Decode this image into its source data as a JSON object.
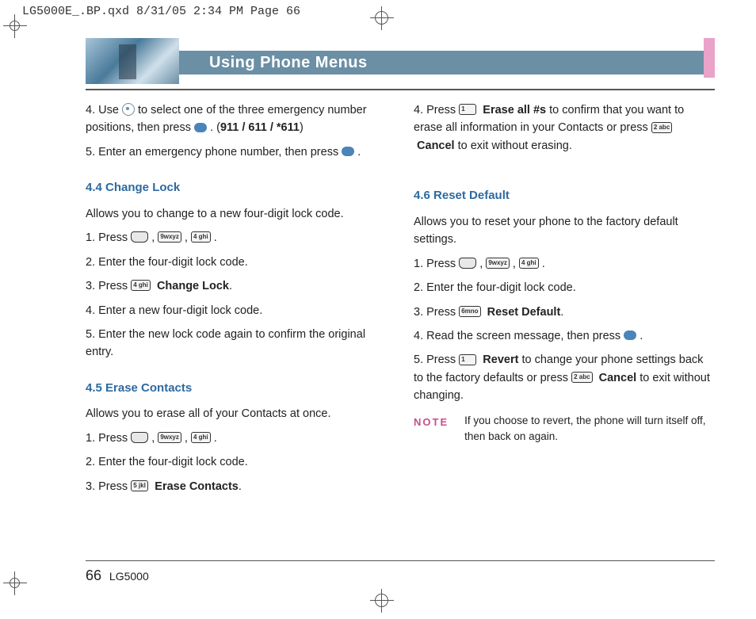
{
  "meta_header": "LG5000E_.BP.qxd  8/31/05  2:34 PM  Page 66",
  "title": "Using Phone Menus",
  "left": {
    "step4_a": "4. Use ",
    "step4_b": " to select one of the three emergency number positions, then press ",
    "step4_c": ".   (",
    "emerg": "911 / 611 / *611",
    "step4_d": ")",
    "step5": "5. Enter an emergency phone number, then press ",
    "step5_end": ".",
    "sec44": "4.4 Change Lock",
    "s44_intro": "Allows you to change to a new four-digit lock code.",
    "s44_1a": "1. Press ",
    "s44_1b": " , ",
    "s44_1c": " , ",
    "s44_1d": " .",
    "s44_2": "2. Enter the four-digit lock code.",
    "s44_3a": "3. Press ",
    "s44_3b": "Change Lock",
    "s44_3c": ".",
    "s44_4": "4. Enter a new four-digit lock code.",
    "s44_5": "5. Enter the new lock code again to confirm the original entry.",
    "sec45": "4.5 Erase Contacts",
    "s45_intro": "Allows you to erase all of your Contacts at once.",
    "s45_1a": "1. Press ",
    "s45_1b": " , ",
    "s45_1c": " , ",
    "s45_1d": " .",
    "s45_2": "2. Enter the four-digit lock code.",
    "s45_3a": "3. Press ",
    "s45_3b": "Erase Contacts",
    "s45_3c": "."
  },
  "right": {
    "step4_a": "4. Press ",
    "step4_b": "Erase all #s",
    "step4_c": " to confirm that you want to erase all information in your Contacts or press ",
    "step4_d": "Cancel",
    "step4_e": " to exit without erasing.",
    "sec46": "4.6 Reset Default",
    "s46_intro": "Allows you to reset your phone to the factory default settings.",
    "s46_1a": "1. Press ",
    "s46_1b": " , ",
    "s46_1c": " , ",
    "s46_1d": " .",
    "s46_2": "2. Enter the four-digit lock code.",
    "s46_3a": "3. Press ",
    "s46_3b": "Reset Default",
    "s46_3c": ".",
    "s46_4a": "4. Read the screen message, then press ",
    "s46_4b": ".",
    "s46_5a": "5. Press ",
    "s46_5b": "Revert",
    "s46_5c": " to change your phone settings back to the factory defaults or press ",
    "s46_5d": "Cancel",
    "s46_5e": " to exit without changing.",
    "note_label": "NOTE",
    "note_text": "If you choose to revert, the phone will turn itself off, then back on again."
  },
  "keys": {
    "k1": "1",
    "k2": "2 abc",
    "k4": "4 ghi",
    "k5": "5 jkl",
    "k6": "6mno",
    "k9": "9wxyz"
  },
  "footer": {
    "page": "66",
    "model": "LG5000"
  }
}
